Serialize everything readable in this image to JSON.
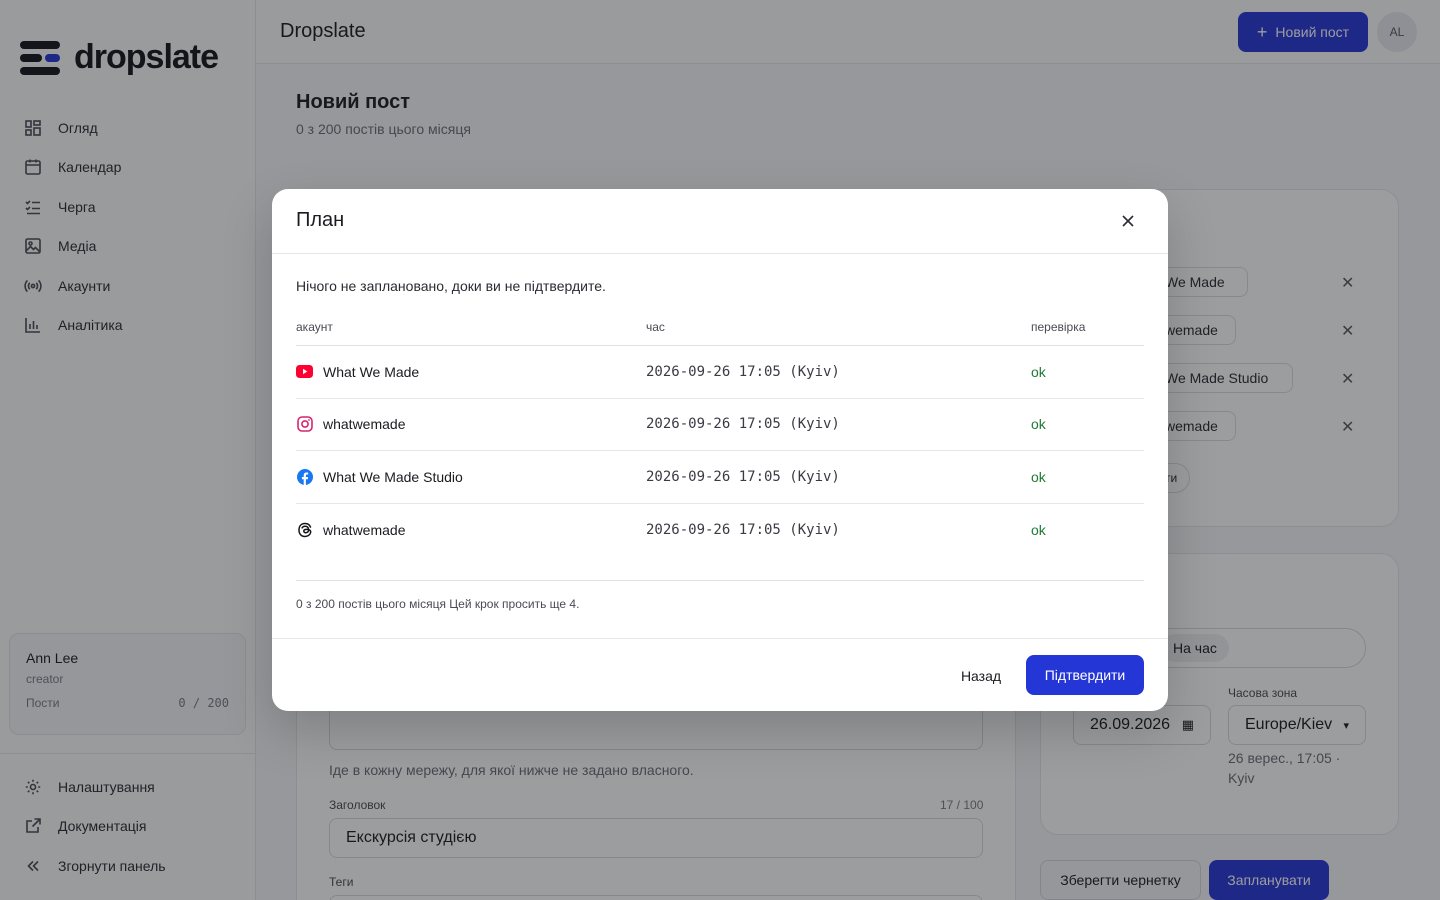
{
  "sidebar": {
    "brand": "dropslate",
    "nav": [
      {
        "label": "Огляд",
        "icon": "grid-icon"
      },
      {
        "label": "Календар",
        "icon": "calendar-icon"
      },
      {
        "label": "Черга",
        "icon": "queue-icon"
      },
      {
        "label": "Медіа",
        "icon": "image-icon"
      },
      {
        "label": "Акаунти",
        "icon": "broadcast-icon"
      },
      {
        "label": "Аналітика",
        "icon": "bar-chart-icon"
      }
    ],
    "user": {
      "name": "Ann Lee",
      "role": "creator",
      "posts_label": "Пости",
      "posts_value": "0 / 200"
    },
    "bottom": [
      {
        "label": "Налаштування",
        "icon": "gear-icon"
      },
      {
        "label": "Документація",
        "icon": "external-link-icon"
      },
      {
        "label": "Згорнути панель",
        "icon": "chevrons-left-icon"
      }
    ]
  },
  "topbar": {
    "title": "Dropslate",
    "new_post": "Новий пост",
    "avatar": "AL"
  },
  "page": {
    "title": "Новий пост",
    "subtitle": "0 з 200 постів цього місяця",
    "chips": [
      "We Made",
      "wemade",
      "We Made Studio",
      "wemade"
    ],
    "chip_more": "ти",
    "mode_option": "На час",
    "timezone_label": "Часова зона",
    "date_value": "26.09.2026",
    "timezone_value": "Europe/Kiev",
    "schedule_hint": "26 верес., 17:05 · Kyiv",
    "body_hint": "Іде в кожну мережу, для якої нижче не задано власного.",
    "headline_label": "Заголовок",
    "headline_count": "17 / 100",
    "headline_value": "Екскурсія студією",
    "tags_label": "Теги",
    "save_draft": "Зберегти чернетку",
    "schedule": "Запланувати"
  },
  "modal": {
    "title": "План",
    "note": "Нічого не заплановано, доки ви не підтвердите.",
    "columns": {
      "account": "акаунт",
      "time": "час",
      "check": "перевірка"
    },
    "rows": [
      {
        "account": "What We Made",
        "platform": "youtube-icon",
        "time": "2026-09-26 17:05 (Kyiv)",
        "check": "ok"
      },
      {
        "account": "whatwemade",
        "platform": "instagram-icon",
        "time": "2026-09-26 17:05 (Kyiv)",
        "check": "ok"
      },
      {
        "account": "What We Made Studio",
        "platform": "facebook-icon",
        "time": "2026-09-26 17:05 (Kyiv)",
        "check": "ok"
      },
      {
        "account": "whatwemade",
        "platform": "threads-icon",
        "time": "2026-09-26 17:05 (Kyiv)",
        "check": "ok"
      }
    ],
    "footer_note": "0 з 200 постів цього місяця Цей крок просить ще 4.",
    "back": "Назад",
    "confirm": "Підтвердити"
  },
  "colors": {
    "accent": "#2536d6",
    "ok": "#1e7a35",
    "youtube": "#ff0033",
    "instagram": "#d6246e",
    "facebook": "#1877f2"
  }
}
